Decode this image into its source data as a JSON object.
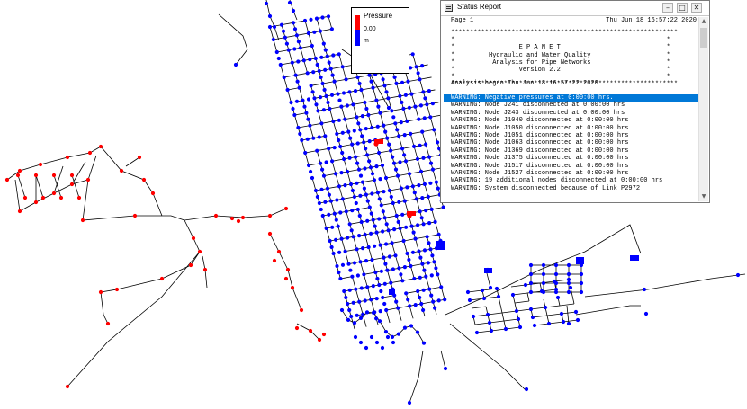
{
  "legend": {
    "title": "Pressure",
    "value": "0.00",
    "unit": "m",
    "colors": {
      "above": "#ff0000",
      "below": "#0000ff"
    }
  },
  "status_window": {
    "title": "Status Report",
    "controls": {
      "minimize": "–",
      "maximize": "□",
      "close": "✕"
    },
    "report": {
      "page": "Page 1",
      "date": "Thu Jun 18 16:57:22 2020",
      "stars": "************************************************************",
      "banner": [
        {
          "edge": "*",
          "text": ""
        },
        {
          "edge": "*",
          "text": "E P A N E T"
        },
        {
          "edge": "*",
          "text": "Hydraulic and Water Quality"
        },
        {
          "edge": "*",
          "text": "Analysis for Pipe Networks"
        },
        {
          "edge": "*",
          "text": "Version 2.2"
        },
        {
          "edge": "*",
          "text": ""
        }
      ],
      "analysis_begun": "Analysis begun Thu Jun 18 16:57:22 2020",
      "warnings": [
        "WARNING: Negative pressures at 0:00:00 hrs.",
        "WARNING: Node J241 disconnected at 0:00:00 hrs",
        "WARNING: Node J243 disconnected at 0:00:00 hrs",
        "WARNING: Node J1040 disconnected at 0:00:00 hrs",
        "WARNING: Node J1050 disconnected at 0:00:00 hrs",
        "WARNING: Node J1051 disconnected at 0:00:00 hrs",
        "WARNING: Node J1063 disconnected at 0:00:00 hrs",
        "WARNING: Node J1369 disconnected at 0:00:00 hrs",
        "WARNING: Node J1375 disconnected at 0:00:00 hrs",
        "WARNING: Node J1517 disconnected at 0:00:00 hrs",
        "WARNING: Node J1527 disconnected at 0:00:00 hrs",
        "WARNING: 19 additional nodes disconnected at 0:00:00 hrs",
        "WARNING: System disconnected because of Link P2972"
      ],
      "selected_index": 0
    }
  }
}
